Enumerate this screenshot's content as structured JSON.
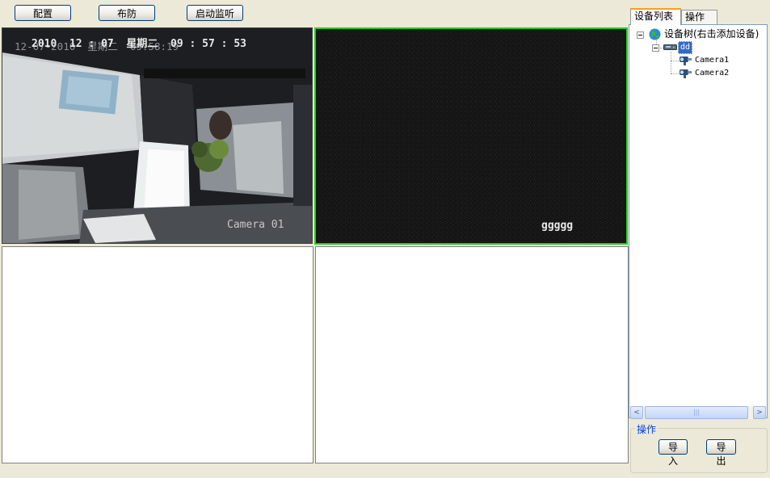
{
  "toolbar": {
    "config_label": "配置",
    "arm_label": "布防",
    "start_monitor_label": "启动监听"
  },
  "video": {
    "cell1": {
      "osd_datetime": "2010  12 : 07  星期二  09 : 57 : 53",
      "osd_ghost": "12-07-2010  星期二  09:58:19",
      "camera_name": "Camera 01"
    },
    "cell2": {
      "camera_name": "ggggg",
      "border_color": "#1ed01e"
    }
  },
  "panel": {
    "tabs": [
      {
        "label": "设备列表",
        "active": true
      },
      {
        "label": "操作",
        "active": false
      }
    ],
    "tree": {
      "root_label": "设备树(右击添加设备)",
      "root_icon": "globe-icon",
      "device_label": "dd",
      "device_icon": "dvr-device-icon",
      "cameras": [
        {
          "label": "Camera1",
          "icon": "camera-icon"
        },
        {
          "label": "Camera2",
          "icon": "camera-icon"
        }
      ]
    },
    "scrollbar": {
      "left_arrow": "<",
      "right_arrow": ">",
      "thumb_grip": "|||"
    },
    "operation_group": {
      "title": "操作",
      "import_label": "导入",
      "export_label": "导出"
    }
  },
  "colors": {
    "window_bg": "#ece9d8",
    "selected_border": "#1ed01e",
    "tab_active_accent": "#f2a31b",
    "selection_bg": "#316ac5"
  }
}
